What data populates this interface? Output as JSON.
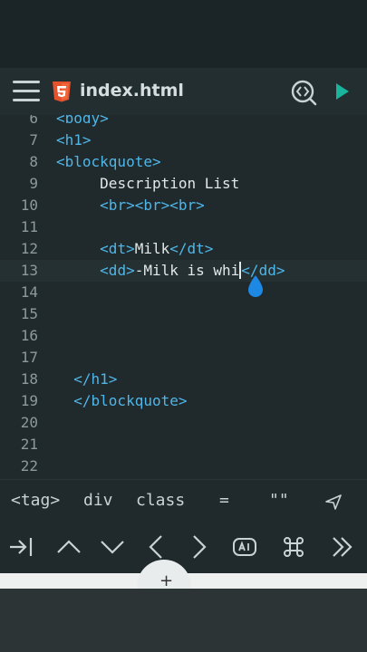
{
  "toolbar": {
    "file_name": "index.html"
  },
  "editor": {
    "lines": [
      {
        "num": "6",
        "tokens": [
          {
            "t": "<body>",
            "c": "tag"
          }
        ]
      },
      {
        "num": "7",
        "tokens": [
          {
            "t": "<h1>",
            "c": "tag"
          }
        ]
      },
      {
        "num": "8",
        "tokens": [
          {
            "t": "<blockquote>",
            "c": "tag"
          }
        ]
      },
      {
        "num": "9",
        "tokens": [
          {
            "t": "     ",
            "c": "txt"
          },
          {
            "t": "Description List",
            "c": "txt"
          }
        ]
      },
      {
        "num": "10",
        "tokens": [
          {
            "t": "     ",
            "c": "txt"
          },
          {
            "t": "<br><br><br>",
            "c": "tag"
          }
        ]
      },
      {
        "num": "11",
        "tokens": []
      },
      {
        "num": "12",
        "tokens": [
          {
            "t": "     ",
            "c": "txt"
          },
          {
            "t": "<dt>",
            "c": "tag"
          },
          {
            "t": "Milk",
            "c": "txt"
          },
          {
            "t": "</dt>",
            "c": "tag"
          }
        ]
      },
      {
        "num": "13",
        "tokens": [
          {
            "t": "     ",
            "c": "txt"
          },
          {
            "t": "<dd>",
            "c": "tag"
          },
          {
            "t": "-Milk is whi",
            "c": "txt"
          },
          {
            "t": "|",
            "c": "cursor"
          },
          {
            "t": "</dd>",
            "c": "tag"
          }
        ],
        "active": true
      },
      {
        "num": "14",
        "tokens": []
      },
      {
        "num": "15",
        "tokens": []
      },
      {
        "num": "16",
        "tokens": []
      },
      {
        "num": "17",
        "tokens": []
      },
      {
        "num": "18",
        "tokens": [
          {
            "t": "  ",
            "c": "txt"
          },
          {
            "t": "</h1>",
            "c": "tag"
          }
        ]
      },
      {
        "num": "19",
        "tokens": [
          {
            "t": "  ",
            "c": "txt"
          },
          {
            "t": "</blockquote>",
            "c": "tag"
          }
        ]
      },
      {
        "num": "20",
        "tokens": []
      },
      {
        "num": "21",
        "tokens": []
      },
      {
        "num": "22",
        "tokens": []
      }
    ]
  },
  "keybar": {
    "keys": [
      "<tag>",
      "div",
      "class",
      "=",
      "\"\""
    ]
  },
  "colors": {
    "tag": "#4fb6e8",
    "accent_play": "#19b49b",
    "html5_orange": "#e5532d",
    "cursor_drop": "#1e88e5"
  }
}
